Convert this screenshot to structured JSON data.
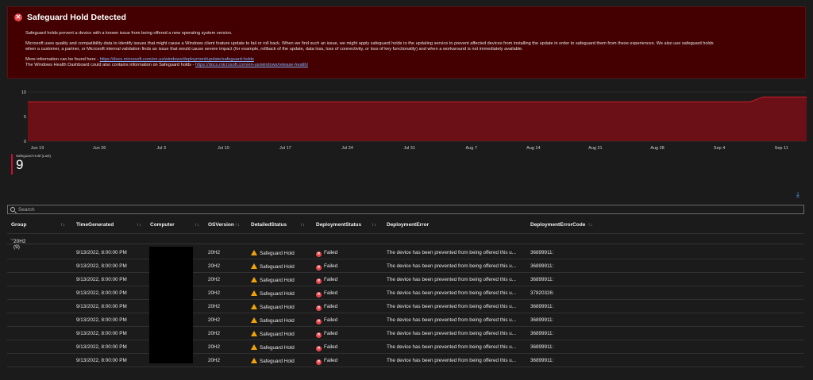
{
  "banner": {
    "title": "Safeguard Hold Detected",
    "p1": "Safeguard holds prevent a device with a known issue from being offered a new operating system version.",
    "p2a": "Microsoft uses quality and compatibility data to identify issues that might cause a Windows client feature update to fail or roll back. When we find such an issue, we might apply safeguard holds to the updating service to prevent affected devices from installing the update in order to safeguard them from these experiences. We also use safeguard holds",
    "p2b": "when a customer, a partner, or Microsoft internal validation finds an issue that would cause severe impact (for example, rollback of the update, data loss, loss of connectivity, or loss of key functionality) and when a workaround is not immediately available.",
    "more_prefix": "More information can be found here - ",
    "more_link": "https://docs.microsoft.com/en-us/windows/deployment/update/safeguard-holds",
    "dash_prefix": "The Windows Health Dashboard could also contains information on Safeguard holds - ",
    "dash_link": "https://docs.microsoft.com/en-us/windows/release-health/"
  },
  "chart_data": {
    "type": "area",
    "x": [
      "Jun 19",
      "Jun 26",
      "Jul 3",
      "Jul 10",
      "Jul 17",
      "Jul 24",
      "Jul 31",
      "Aug 7",
      "Aug 14",
      "Aug 21",
      "Aug 28",
      "Sep 4",
      "Sep 11"
    ],
    "y_ticks": [
      "10",
      "5",
      "0"
    ],
    "ylim": [
      0,
      10
    ],
    "series": [
      {
        "points": [
          [
            0,
            8
          ],
          [
            11.5,
            8
          ],
          [
            11.7,
            9
          ],
          [
            13.2,
            9
          ]
        ]
      }
    ],
    "colors": {
      "fill": "#6b1017",
      "line": "#d01c2b"
    },
    "grid": true
  },
  "summary": {
    "label": "Safeguard Hold (Last)",
    "value": "9"
  },
  "search": {
    "placeholder": "Search"
  },
  "table": {
    "columns": [
      "Group",
      "TimeGenerated",
      "Computer",
      "OSVersion",
      "DetailedStatus",
      "DeploymentStatus",
      "DeploymentError",
      "DeploymentErrorCode"
    ],
    "group_label": "20H2 (9)",
    "rows": [
      {
        "time": "9/13/2022, 8:00:00 PM",
        "os": "20H2",
        "detailed": "Safeguard Hold",
        "status": "Failed",
        "error": "The device has been prevented from being offered this u...",
        "code": "36899911:"
      },
      {
        "time": "9/13/2022, 8:00:00 PM",
        "os": "20H2",
        "detailed": "Safeguard Hold",
        "status": "Failed",
        "error": "The device has been prevented from being offered this u...",
        "code": "36899911:"
      },
      {
        "time": "9/13/2022, 8:00:00 PM",
        "os": "20H2",
        "detailed": "Safeguard Hold",
        "status": "Failed",
        "error": "The device has been prevented from being offered this u...",
        "code": "36899911:"
      },
      {
        "time": "9/13/2022, 8:00:00 PM",
        "os": "20H2",
        "detailed": "Safeguard Hold",
        "status": "Failed",
        "error": "The device has been prevented from being offered this u...",
        "code": "37820326:"
      },
      {
        "time": "9/13/2022, 8:00:00 PM",
        "os": "20H2",
        "detailed": "Safeguard Hold",
        "status": "Failed",
        "error": "The device has been prevented from being offered this u...",
        "code": "36899911:"
      },
      {
        "time": "9/13/2022, 8:00:00 PM",
        "os": "20H2",
        "detailed": "Safeguard Hold",
        "status": "Failed",
        "error": "The device has been prevented from being offered this u...",
        "code": "36899911:"
      },
      {
        "time": "9/13/2022, 8:00:00 PM",
        "os": "20H2",
        "detailed": "Safeguard Hold",
        "status": "Failed",
        "error": "The device has been prevented from being offered this u...",
        "code": "36899911:"
      },
      {
        "time": "9/13/2022, 8:00:00 PM",
        "os": "20H2",
        "detailed": "Safeguard Hold",
        "status": "Failed",
        "error": "The device has been prevented from being offered this u...",
        "code": "36899911:"
      },
      {
        "time": "9/13/2022, 8:00:00 PM",
        "os": "20H2",
        "detailed": "Safeguard Hold",
        "status": "Failed",
        "error": "The device has been prevented from being offered this u...",
        "code": "36899911:"
      }
    ]
  }
}
